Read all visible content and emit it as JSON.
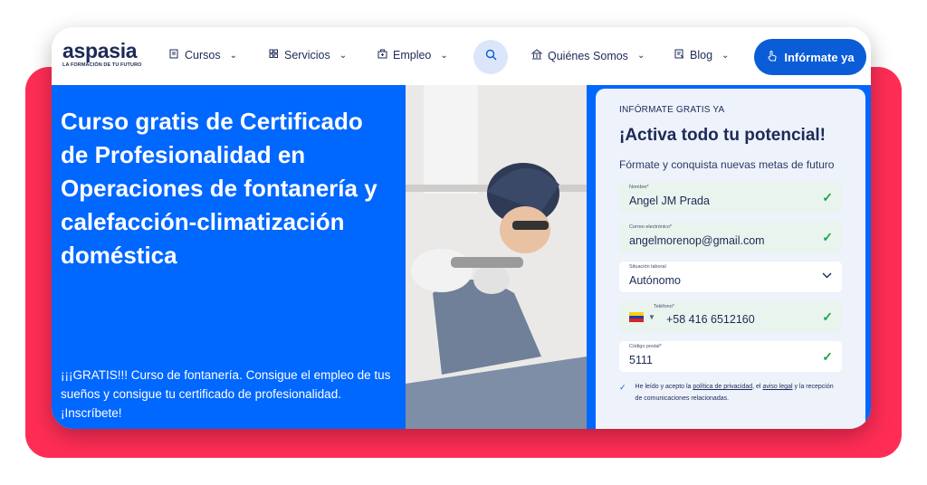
{
  "brand": {
    "logo_text": "aspasia",
    "tagline": "LA FORMACIÓN DE TU FUTURO"
  },
  "nav": {
    "items": [
      {
        "label": "Cursos",
        "icon": "courses-icon"
      },
      {
        "label": "Servicios",
        "icon": "services-icon"
      },
      {
        "label": "Empleo",
        "icon": "job-icon"
      },
      {
        "label": "Quiénes Somos",
        "icon": "building-icon"
      },
      {
        "label": "Blog",
        "icon": "blog-icon"
      }
    ],
    "cta_label": "Infórmate ya",
    "colors": {
      "nav_text": "#1c2a57",
      "cta": "#0b5cd7"
    }
  },
  "hero": {
    "title": "Curso gratis de Certificado de Profesionalidad en Operaciones de fontanería y calefacción-climatización doméstica",
    "subtitle": "¡¡¡GRATIS!!! Curso de fontanería. Consigue el empleo de tus sueños y consigue tu certificado de profesionalidad. ¡Inscríbete!",
    "background": "#0067ff"
  },
  "form": {
    "kicker": "INFÓRMATE GRATIS YA",
    "title": "¡Activa todo tu potencial!",
    "description": "Fórmate y conquista nuevas metas de futuro",
    "fields": {
      "name": {
        "label": "Nombre*",
        "value": "Angel JM Prada"
      },
      "email": {
        "label": "Correo electrónico*",
        "value": "angelmorenop@gmail.com"
      },
      "job": {
        "label": "Situación laboral",
        "value": "Autónomo"
      },
      "phone": {
        "label": "Teléfono*",
        "value": "+58 416 6512160"
      },
      "postal": {
        "label": "Código postal*",
        "value": "5111"
      }
    },
    "consent": {
      "prefix": "He leído y acepto la ",
      "privacy_link": "política de privacidad",
      "middle": ", el ",
      "legal_link": "aviso legal",
      "suffix": " y la recepción de comunicaciones relacionadas."
    },
    "valid_color": "#21a04a"
  },
  "frame": {
    "accent_background": "#ff2d55"
  }
}
